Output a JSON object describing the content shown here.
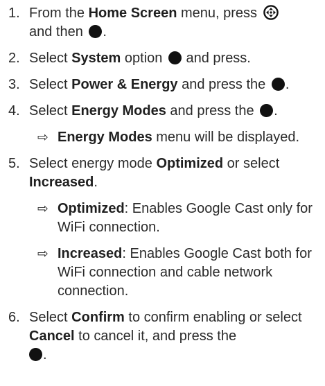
{
  "steps": [
    {
      "number": "1.",
      "t1": "From the ",
      "b1": "Home Screen",
      "t2": " menu, press ",
      "t3": " and then ",
      "t4": ".",
      "icons": [
        "navigation-pad-icon",
        "ok-button-icon"
      ]
    },
    {
      "number": "2.",
      "t1": "Select ",
      "b1": "System",
      "t2": " option ",
      "t3": " and press.",
      "icons": [
        "ok-button-icon"
      ]
    },
    {
      "number": "3.",
      "t1": "Select ",
      "b1": "Power & Energy",
      "t2": " and press the ",
      "t3": ".",
      "icons": [
        "ok-button-icon"
      ]
    },
    {
      "number": "4.",
      "t1": "Select ",
      "b1": "Energy Modes",
      "t2": " and press the ",
      "t3": ".",
      "icons": [
        "ok-button-icon"
      ],
      "result": {
        "arrow": "⇨",
        "b1": "Energy Modes",
        "t1": " menu will be displayed."
      }
    },
    {
      "number": "5.",
      "t1": "Select energy mode ",
      "b1": "Optimized",
      "t2": " or select ",
      "b2": "Increased",
      "t3": ".",
      "results": [
        {
          "arrow": "⇨",
          "b1": "Optimized",
          "t1": ": Enables Google Cast only for WiFi connection."
        },
        {
          "arrow": "⇨",
          "b1": "Increased",
          "t1": ": Enables Google Cast both for WiFi connection and cable network connection."
        }
      ]
    },
    {
      "number": "6.",
      "t1": "Select ",
      "b1": "Confirm",
      "t2": " to confirm enabling or select ",
      "b2": "Cancel",
      "t3": " to cancel it, and press the ",
      "t4": ".",
      "icons": [
        "ok-button-icon"
      ]
    }
  ],
  "colors": {
    "text": "#2a2a2a",
    "icon": "#111111"
  }
}
